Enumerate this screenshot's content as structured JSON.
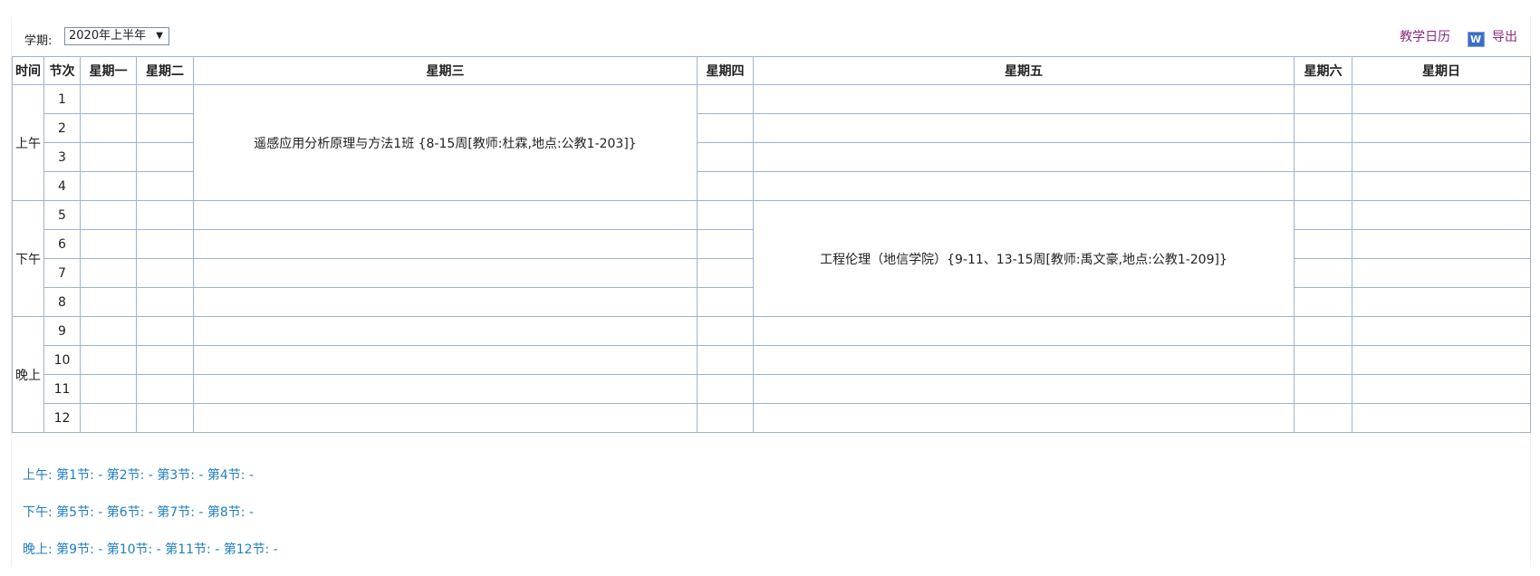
{
  "term": {
    "label": "学期:",
    "value": "2020年上半年",
    "arrow": "▼"
  },
  "links": {
    "calendar": "教学日历",
    "export_icon": "W",
    "export": "导出"
  },
  "headers": [
    "时间",
    "节次",
    "星期一",
    "星期二",
    "星期三",
    "星期四",
    "星期五",
    "星期六",
    "星期日"
  ],
  "sessions": {
    "morning": "上午",
    "afternoon": "下午",
    "evening": "晚上"
  },
  "periods": [
    "1",
    "2",
    "3",
    "4",
    "5",
    "6",
    "7",
    "8",
    "9",
    "10",
    "11",
    "12"
  ],
  "courses": {
    "wed": "遥感应用分析原理与方法1班 {8-15周[教师:杜霖,地点:公教1-203]}",
    "fri": "工程伦理（地信学院）{9-11、13-15周[教师:禹文豪,地点:公教1-209]}"
  },
  "period_times": {
    "morning": "上午:  第1节: - 第2节: - 第3节: - 第4节: -",
    "afternoon": "下午:  第5节: - 第6节: - 第7节: - 第8节: -",
    "evening": "晚上:  第9节: - 第10节: - 第11节: - 第12节: -"
  }
}
